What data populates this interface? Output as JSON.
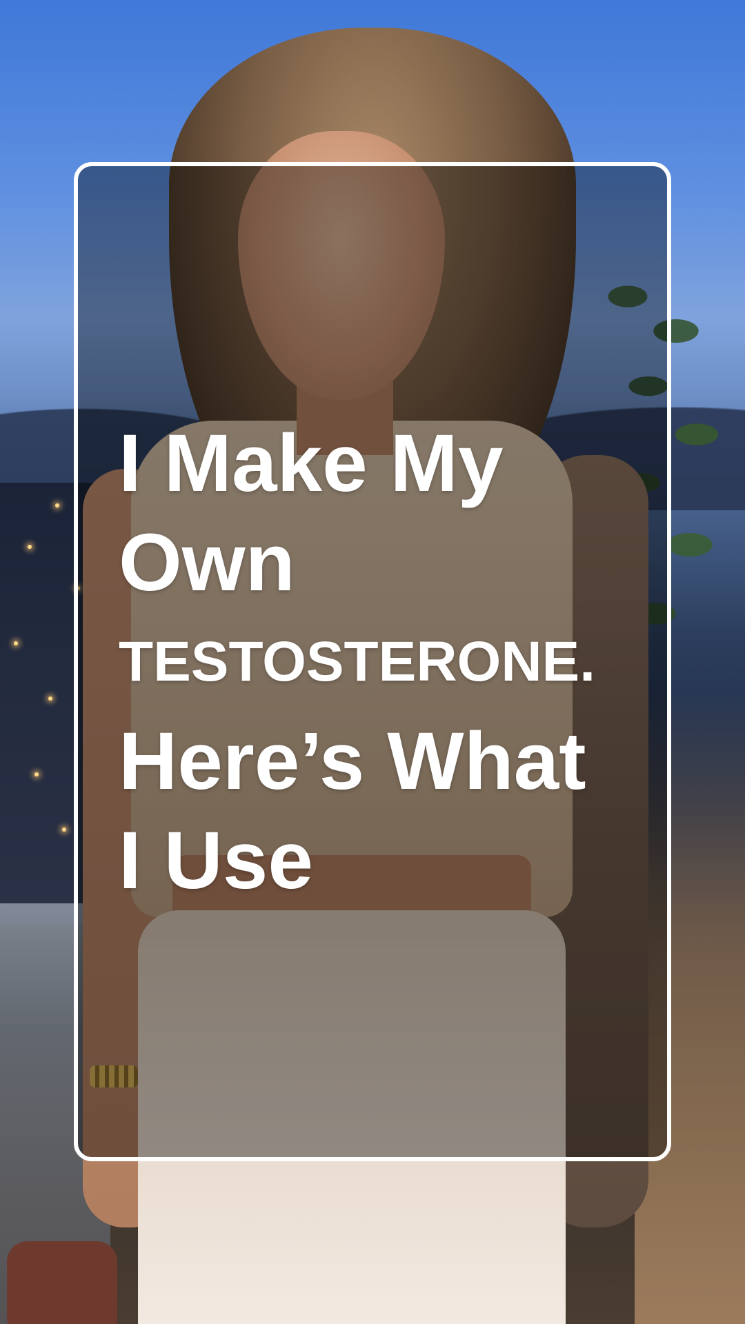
{
  "overlay": {
    "headline_lines": {
      "line1": "I Make My",
      "line2": "Own",
      "line3": "TESTOSTERONE.",
      "line4": "Here’s What",
      "line5": "I Use"
    },
    "card_border_color": "#ffffff",
    "text_color": "#ffffff"
  },
  "background": {
    "description_icon": "photo-background"
  }
}
